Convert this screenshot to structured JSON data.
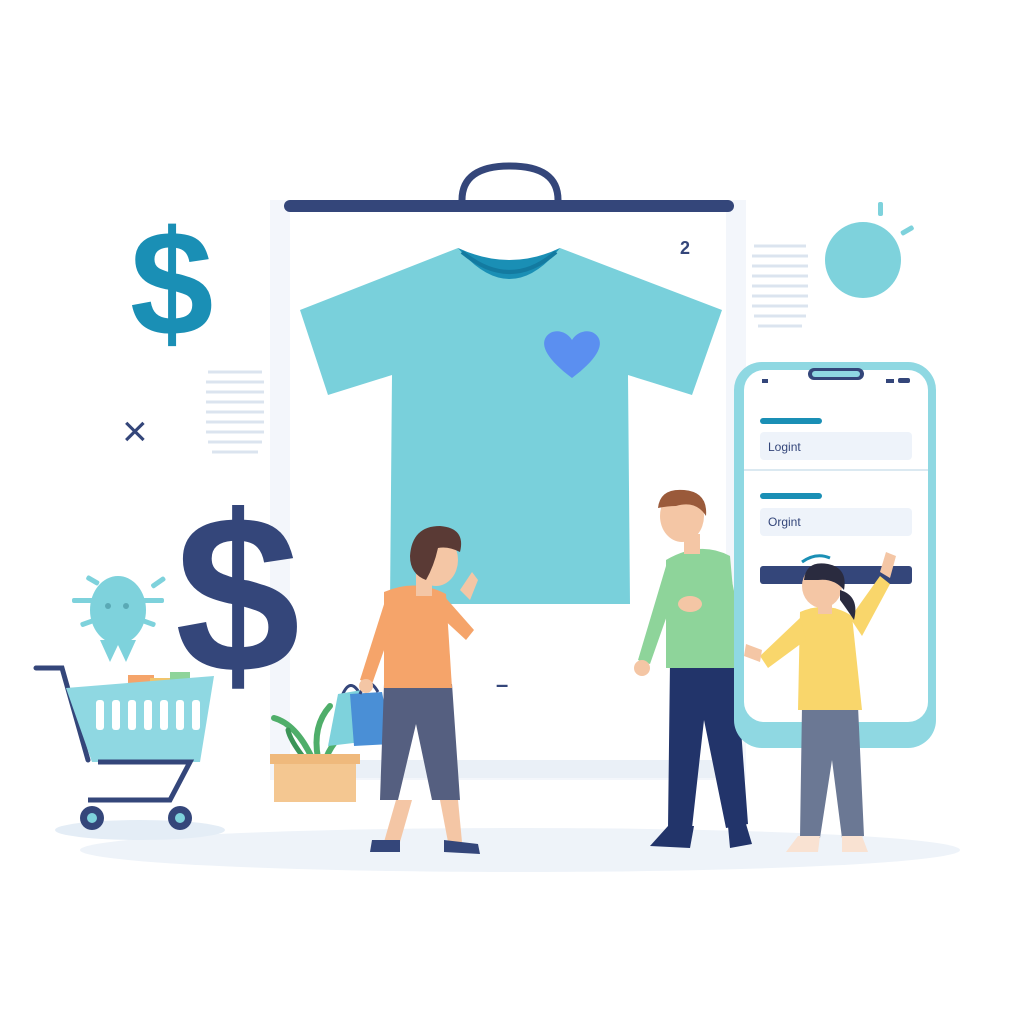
{
  "illustration": {
    "currency_symbol": "$",
    "close_mark": "×",
    "board_number": "2",
    "board_dash": "–"
  },
  "phone": {
    "field_1_text": "Logint",
    "field_2_text": "Orgint"
  },
  "colors": {
    "navy": "#34467a",
    "teal": "#1a8fb5",
    "shirt": "#79d0db",
    "heart": "#5b8ff0",
    "phone_frame": "#8fd8e2",
    "orange_shirt": "#f5a46a",
    "green_shirt": "#8ed49a",
    "yellow_shirt": "#f9d66b"
  },
  "icons": [
    "dollar-icon",
    "close-icon",
    "heart-icon",
    "sun-icon",
    "bug-icon",
    "shopping-cart-icon",
    "shopping-bag-icon",
    "plant-icon",
    "phone-icon"
  ]
}
